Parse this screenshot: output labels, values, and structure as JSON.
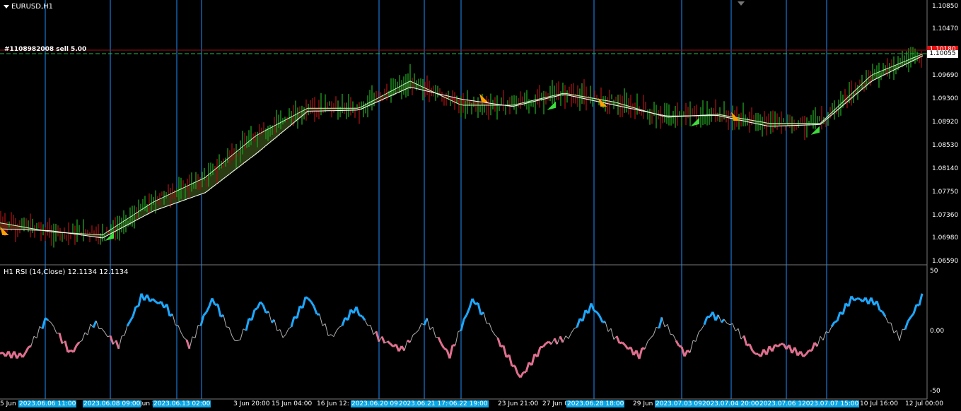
{
  "window": {
    "symbol_label": "EURUSD,H1"
  },
  "order": {
    "label": "#1108982008 sell 5.00"
  },
  "price_tags": {
    "ask": "1.10180",
    "bid": "1.10055"
  },
  "price_axis": {
    "labels": [
      "1.10850",
      "1.10470",
      "1.09690",
      "1.09300",
      "1.08920",
      "1.08530",
      "1.08140",
      "1.07750",
      "1.07360",
      "1.06980",
      "1.06590"
    ]
  },
  "rsi": {
    "header": "H1 RSI (14,Close) 12.1134 12.1134",
    "axis_labels": [
      "50",
      "0.00",
      "-50"
    ]
  },
  "time_axis": {
    "labels": [
      "5 Jun 2023",
      "Jun 20",
      "3 Jun 20:00",
      "15 Jun 04:00",
      "16 Jun 12:",
      "23 Jun 21:00",
      "27 Jun 0",
      "29 Jun",
      "10 Jul 16:00",
      "12 Jul 00:00"
    ],
    "highlighted": [
      "2023.06.06 11:00",
      "2023.06.08 09:00",
      "2023.06.13 02:00",
      "2023.06.20 09",
      "2023.06.21 17:00",
      "06.22 19:00",
      "2023.06.28 18:00",
      "2023.07.03 09:0",
      "2023.07.04 20:00",
      "2023.07.06 1",
      "2023.07.07 15:00"
    ]
  },
  "colors": {
    "background": "#000000",
    "bull_candle": "#1e8c1e",
    "bear_candle": "#8c1010",
    "ma_fast": "#ffffff",
    "band_bull": "#2a3a12",
    "band_bear": "#5a0c10",
    "vline": "#1e90ff",
    "order_line": "#a01010",
    "bid_line": "#20c040",
    "rsi_up": "#1ea8ff",
    "rsi_down": "#e07090",
    "rsi_neutral": "#b0b0b0",
    "arrow_buy": "#3cdc3c",
    "arrow_sell": "#ffa000",
    "tag_ask": "#e01010",
    "tag_bid": "#ffffff"
  },
  "chart_data": {
    "type": "line",
    "title": "EURUSD,H1",
    "ylim": [
      1.0659,
      1.1085
    ],
    "x": [
      "5 Jun",
      "6 Jun",
      "8 Jun",
      "13 Jun",
      "15 Jun",
      "16 Jun",
      "20 Jun",
      "21 Jun",
      "22 Jun",
      "23 Jun",
      "27 Jun",
      "28 Jun",
      "29 Jun",
      "3 Jul",
      "4 Jul",
      "6 Jul",
      "7 Jul",
      "10 Jul",
      "12 Jul"
    ],
    "series": [
      {
        "values": [
          1.0725,
          1.071,
          1.0705,
          1.076,
          1.08,
          1.087,
          1.0915,
          1.0915,
          1.096,
          1.092,
          1.092,
          1.094,
          1.0925,
          1.09,
          1.0905,
          1.089,
          1.089,
          1.097,
          1.1005
        ]
      },
      {
        "values": [
          1.0715,
          1.0712,
          1.07,
          1.0745,
          1.0775,
          1.084,
          1.091,
          1.0912,
          1.095,
          1.093,
          1.0918,
          1.0938,
          1.092,
          1.0902,
          1.0903,
          1.0885,
          1.0888,
          1.096,
          1.1002
        ]
      }
    ]
  },
  "rsi_data": {
    "type": "line",
    "ylim": [
      -50,
      50
    ],
    "values": [
      -18,
      -20,
      12,
      -18,
      8,
      -12,
      30,
      22,
      -12,
      28,
      -10,
      25,
      -5,
      30,
      -5,
      20,
      -5,
      -15,
      10,
      -20,
      28,
      -5,
      -38,
      -10,
      -5,
      22,
      -5,
      -20,
      10,
      -20,
      15,
      5,
      -20,
      -10,
      -20,
      0,
      28,
      25,
      -5,
      30
    ]
  }
}
